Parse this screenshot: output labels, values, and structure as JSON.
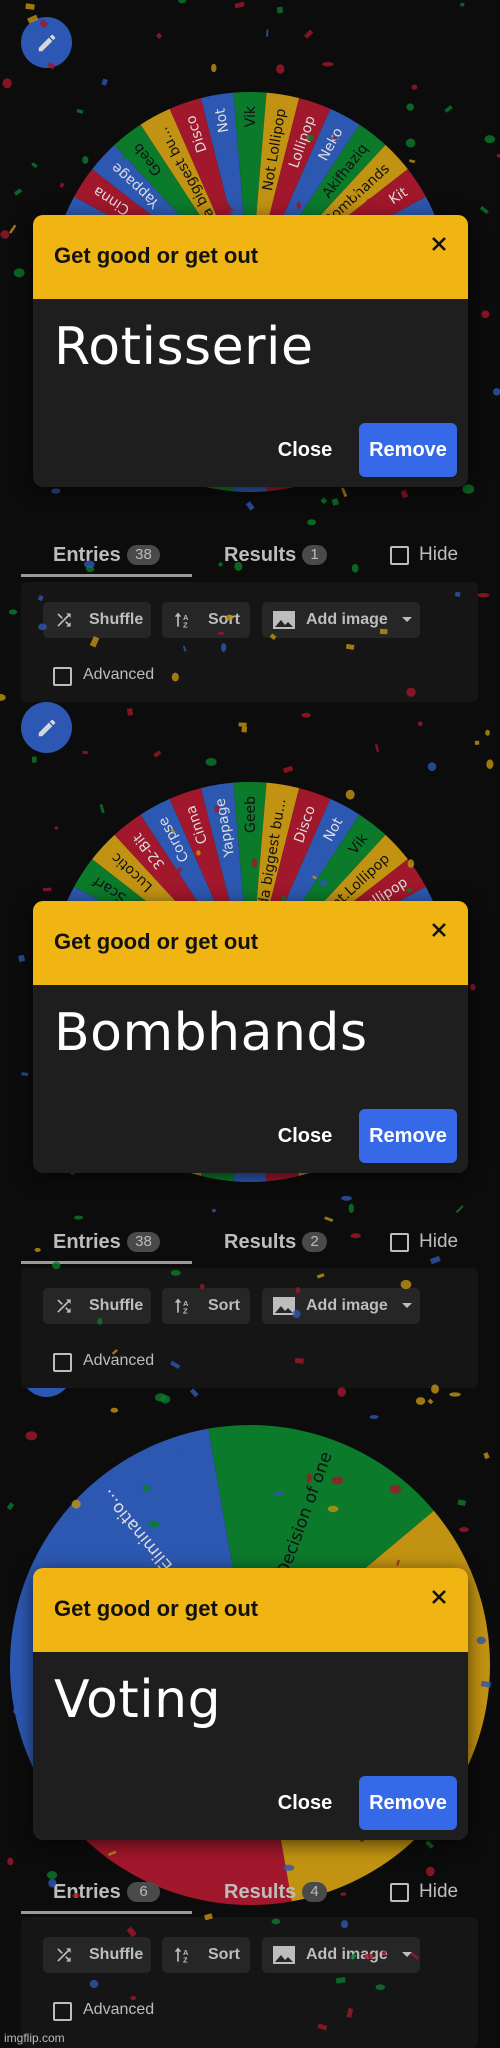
{
  "colors": {
    "red": "#a1172b",
    "blue": "#2d58b1",
    "green": "#0b7a2b",
    "yellow": "#c29312",
    "dialog_header": "#f0b513",
    "remove_button": "#3669e8",
    "background": "#0c0c0c"
  },
  "panels": [
    {
      "wheel": {
        "entry_count": 38,
        "slices": [
          {
            "label": "Cinna",
            "color": "red"
          },
          {
            "label": "Yappage",
            "color": "blue"
          },
          {
            "label": "Geeb",
            "color": "green"
          },
          {
            "label": "I'm da biggest bu...",
            "color": "yellow"
          },
          {
            "label": "Disco",
            "color": "red"
          },
          {
            "label": "Not",
            "color": "blue"
          },
          {
            "label": "Vik",
            "color": "green"
          },
          {
            "label": "Not Lollipop",
            "color": "yellow"
          },
          {
            "label": "Lollipop",
            "color": "red"
          },
          {
            "label": "Neko",
            "color": "blue"
          },
          {
            "label": "Akifhaziq",
            "color": "green"
          },
          {
            "label": "Bombhands",
            "color": "yellow"
          },
          {
            "label": "Kit",
            "color": "red"
          }
        ]
      },
      "dialog": {
        "title": "Get good or get out",
        "result": "Rotisserie",
        "close_label": "Close",
        "remove_label": "Remove",
        "close_icon": "close-icon"
      },
      "tabs": {
        "entries_label": "Entries",
        "entries_count": "38",
        "results_label": "Results",
        "results_count": "1",
        "hide_label": "Hide"
      },
      "toolbar": {
        "shuffle_label": "Shuffle",
        "sort_label": "Sort",
        "add_image_label": "Add image",
        "advanced_label": "Advanced"
      }
    },
    {
      "wheel": {
        "entry_count": 38,
        "slices": [
          {
            "label": "Scarf",
            "color": "green"
          },
          {
            "label": "Lucotic",
            "color": "yellow"
          },
          {
            "label": "32-Bit",
            "color": "red"
          },
          {
            "label": "Corpse",
            "color": "blue"
          },
          {
            "label": "Cinna",
            "color": "red"
          },
          {
            "label": "Yappage",
            "color": "blue"
          },
          {
            "label": "Geeb",
            "color": "green"
          },
          {
            "label": "I'm da biggest bu...",
            "color": "yellow"
          },
          {
            "label": "Disco",
            "color": "red"
          },
          {
            "label": "Not",
            "color": "blue"
          },
          {
            "label": "Vik",
            "color": "green"
          },
          {
            "label": "Not.Lollipop",
            "color": "yellow"
          },
          {
            "label": "Lollipop",
            "color": "red"
          }
        ]
      },
      "dialog": {
        "title": "Get good or get out",
        "result": "Bombhands",
        "close_label": "Close",
        "remove_label": "Remove",
        "close_icon": "close-icon"
      },
      "tabs": {
        "entries_label": "Entries",
        "entries_count": "38",
        "results_label": "Results",
        "results_count": "2",
        "hide_label": "Hide"
      },
      "toolbar": {
        "shuffle_label": "Shuffle",
        "sort_label": "Sort",
        "add_image_label": "Add image",
        "advanced_label": "Advanced"
      }
    },
    {
      "wheel": {
        "entry_count": 6,
        "slices": [
          {
            "label": "dom Eliminatio...",
            "color": "blue"
          },
          {
            "label": "Decision of one",
            "color": "green"
          },
          {
            "label": "",
            "color": "yellow"
          }
        ]
      },
      "dialog": {
        "title": "Get good or get out",
        "result": "Voting",
        "close_label": "Close",
        "remove_label": "Remove",
        "close_icon": "close-icon"
      },
      "tabs": {
        "entries_label": "Entries",
        "entries_count": "6",
        "results_label": "Results",
        "results_count": "4",
        "hide_label": "Hide"
      },
      "toolbar": {
        "shuffle_label": "Shuffle",
        "sort_label": "Sort",
        "add_image_label": "Add image",
        "advanced_label": "Advanced"
      }
    }
  ],
  "watermark": "imgflip.com"
}
